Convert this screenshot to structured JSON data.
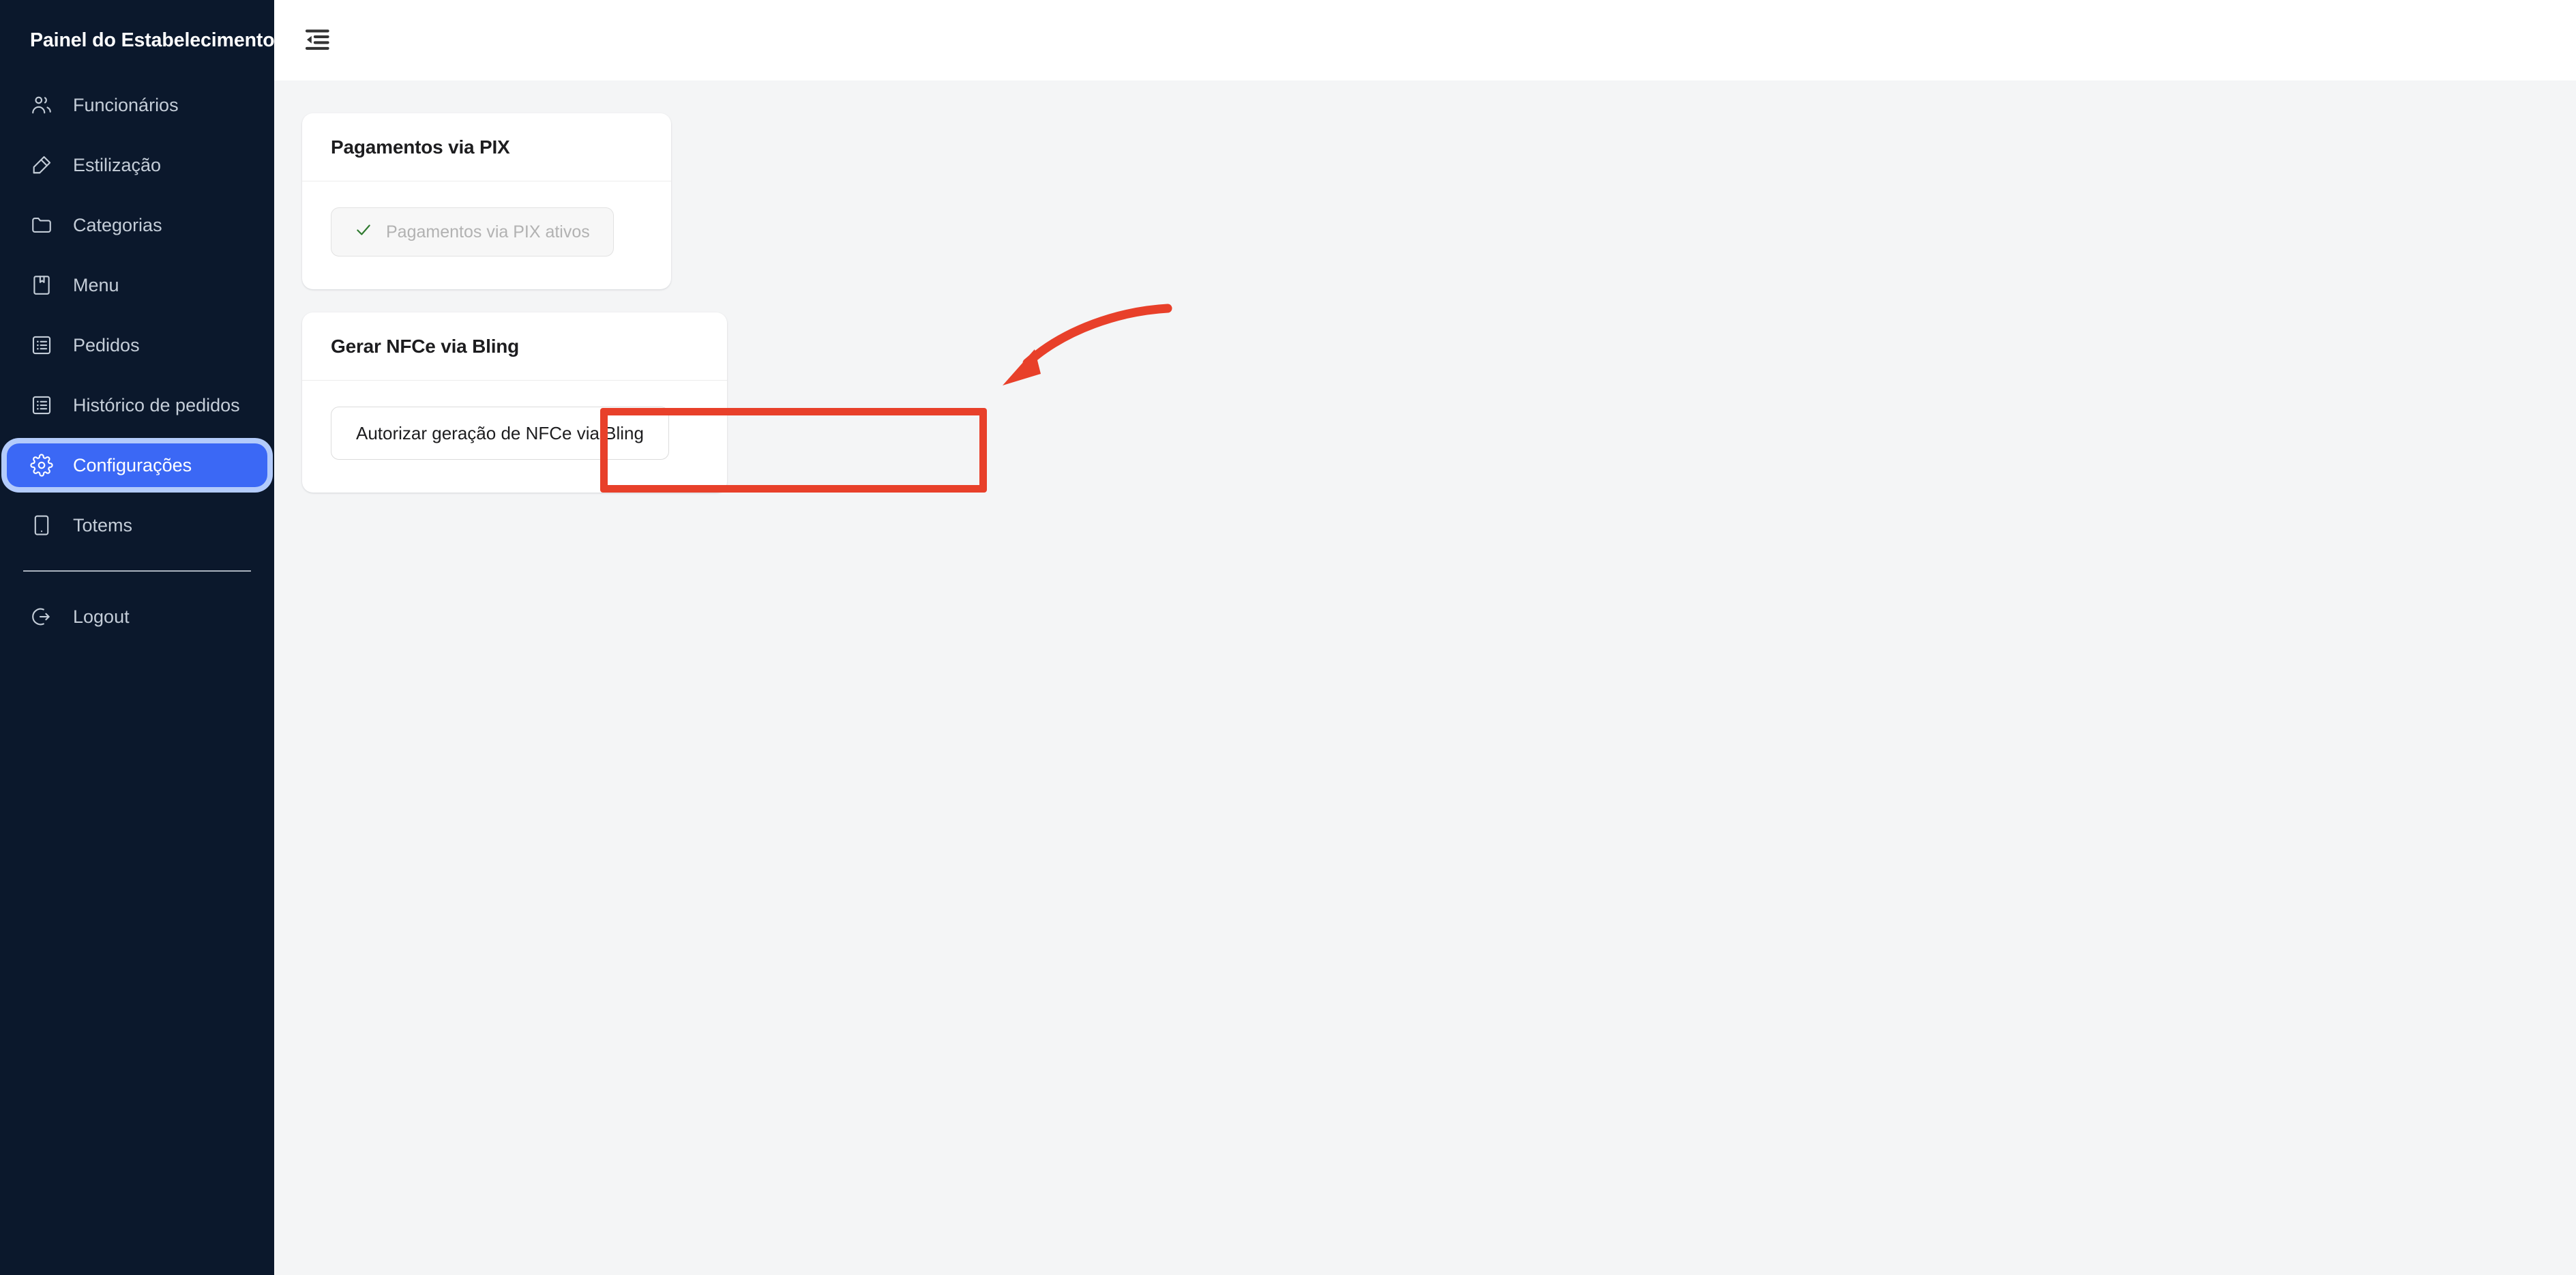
{
  "sidebar": {
    "title": "Painel do Estabelecimento",
    "items": [
      {
        "label": "Funcionários",
        "icon": "users-icon",
        "active": false
      },
      {
        "label": "Estilização",
        "icon": "highlighter-icon",
        "active": false
      },
      {
        "label": "Categorias",
        "icon": "folder-icon",
        "active": false
      },
      {
        "label": "Menu",
        "icon": "book-icon",
        "active": false
      },
      {
        "label": "Pedidos",
        "icon": "list-box-icon",
        "active": false
      },
      {
        "label": "Histórico de pedidos",
        "icon": "list-box-icon",
        "active": false
      },
      {
        "label": "Configurações",
        "icon": "gear-icon",
        "active": true
      },
      {
        "label": "Totems",
        "icon": "tablet-icon",
        "active": false
      }
    ],
    "logout": {
      "label": "Logout",
      "icon": "logout-icon"
    },
    "colors": {
      "background": "#0b182c",
      "item_text": "#c4cdd8",
      "active_background": "#3b68f5",
      "active_ring": "#b3cbfb",
      "active_text": "#ffffff"
    }
  },
  "topbar": {
    "collapse_icon": "list-collapse-icon"
  },
  "cards": {
    "pix": {
      "title": "Pagamentos via PIX",
      "status_button": {
        "label": "Pagamentos via PIX ativos",
        "icon": "check-icon",
        "state": "disabled",
        "check_color": "#2f7a2f",
        "text_color": "#b2b2b2"
      }
    },
    "nfce": {
      "title": "Gerar NFCe via Bling",
      "authorize_button": {
        "label": "Autorizar geração de NFCe via Bling",
        "state": "enabled"
      }
    }
  },
  "annotations": {
    "highlight_box": {
      "color": "#e8402a",
      "target": "Autorizar geração de NFCe via Bling"
    },
    "arrow": {
      "color": "#e8402a",
      "direction": "down-left"
    }
  }
}
